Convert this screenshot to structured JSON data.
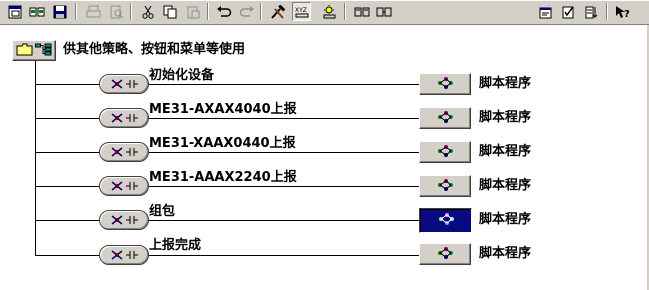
{
  "toolbar": {
    "icons": [
      "window-icon",
      "network-icon",
      "save-icon",
      "print-icon",
      "print-preview-icon",
      "cut-icon",
      "copy-icon",
      "paste-icon",
      "undo-icon",
      "redo-icon",
      "tools-icon",
      "xyz-icon",
      "highlight-icon",
      "split-view-icon",
      "merge-view-icon",
      "properties-icon",
      "check-icon",
      "sort-icon",
      "help-icon"
    ]
  },
  "tree": {
    "root": {
      "label": "供其他策略、按钮和菜单等使用"
    },
    "items": [
      {
        "label": "初始化设备",
        "script_label": "脚本程序",
        "selected": false
      },
      {
        "label": "ME31-AXAX4040上报",
        "script_label": "脚本程序",
        "selected": false
      },
      {
        "label": "ME31-XAAX0440上报",
        "script_label": "脚本程序",
        "selected": false
      },
      {
        "label": "ME31-AAAX2240上报",
        "script_label": "脚本程序",
        "selected": false
      },
      {
        "label": "组包",
        "script_label": "脚本程序",
        "selected": true
      },
      {
        "label": "上报完成",
        "script_label": "脚本程序",
        "selected": false
      }
    ]
  },
  "colors": {
    "toolbar_bg": "#d4d0c8",
    "selected_bg": "#0a0a80",
    "line": "#000000"
  }
}
